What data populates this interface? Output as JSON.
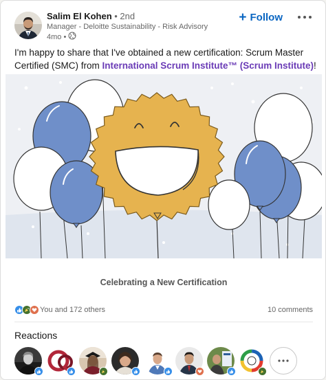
{
  "post": {
    "author": {
      "name": "Salim El Kohen",
      "degree": "• 2nd",
      "headline": "Manager - Deloitte Sustainability - Risk Advisory",
      "time": "4mo •",
      "visibility_icon": "globe-icon"
    },
    "follow_label": "Follow",
    "more_icon": "ellipsis-icon",
    "text_before": "I'm happy to share that I've obtained a new certification: Scrum Master Certified (SMC) from ",
    "link_text": "International Scrum Institute™ (Scrum Institute)",
    "text_after": "!",
    "caption": "Celebrating a New Certification"
  },
  "social": {
    "reaction_icons": [
      "like-icon",
      "celebrate-icon",
      "love-icon"
    ],
    "reactions_text": "You and 172 others",
    "comments_text": "10 comments"
  },
  "reactions": {
    "title": "Reactions",
    "more_icon": "ellipsis-icon"
  },
  "colors": {
    "accent": "#0a66c2",
    "link": "#6a3bb6",
    "badge_gold": "#e6b34f",
    "balloon_blue": "#6f8fc9"
  }
}
